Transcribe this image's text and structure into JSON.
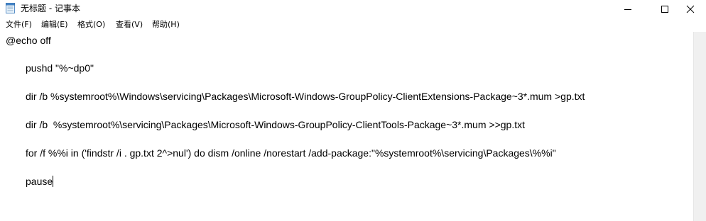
{
  "window": {
    "title": "无标题 - 记事本"
  },
  "titlebar_icons": {
    "app": "notepad-icon",
    "minimize": "minimize-icon",
    "maximize": "maximize-icon",
    "close": "close-icon"
  },
  "menu": [
    {
      "label": "文件(F)"
    },
    {
      "label": "编辑(E)"
    },
    {
      "label": "格式(O)"
    },
    {
      "label": "查看(V)"
    },
    {
      "label": "帮助(H)"
    }
  ],
  "editor": {
    "lines": [
      "@echo off",
      "pushd \"%~dp0\"",
      "dir /b %systemroot%\\Windows\\servicing\\Packages\\Microsoft-Windows-GroupPolicy-ClientExtensions-Package~3*.mum >gp.txt",
      "dir /b  %systemroot%\\servicing\\Packages\\Microsoft-Windows-GroupPolicy-ClientTools-Package~3*.mum >>gp.txt",
      "for /f %%i in ('findstr /i . gp.txt 2^>nul') do dism /online /norestart /add-package:\"%systemroot%\\servicing\\Packages\\%%i\"",
      "pause"
    ]
  }
}
